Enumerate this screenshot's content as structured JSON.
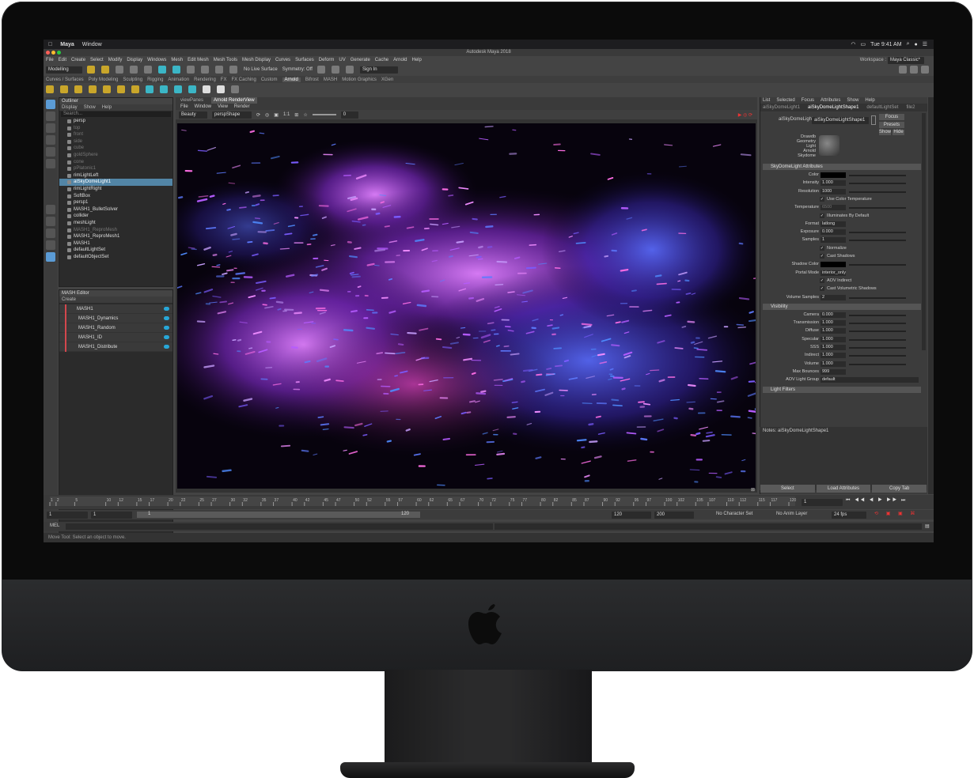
{
  "mac_menubar": {
    "app": "Maya",
    "window": "Window",
    "clock": "Tue 9:41 AM"
  },
  "window_title": "Autodesk Maya 2018",
  "menus": [
    "File",
    "Edit",
    "Create",
    "Select",
    "Modify",
    "Display",
    "Windows",
    "Mesh",
    "Edit Mesh",
    "Mesh Tools",
    "Mesh Display",
    "Curves",
    "Surfaces",
    "Deform",
    "UV",
    "Generate",
    "Cache",
    "Arnold",
    "Help"
  ],
  "workspace": {
    "label": "Workspace :",
    "value": "Maya Classic*"
  },
  "toolbar": {
    "mode": "Modelling",
    "live_surface": "No Live Surface",
    "symmetry": "Symmetry: Off",
    "sign_in": "Sign In"
  },
  "shelf_tabs": [
    "Curves / Surfaces",
    "Poly Modeling",
    "Sculpting",
    "Rigging",
    "Animation",
    "Rendering",
    "FX",
    "FX Caching",
    "Custom",
    "Arnold",
    "Bifrost",
    "MASH",
    "Motion Graphics",
    "XGen"
  ],
  "outliner": {
    "title": "Outliner",
    "menu": [
      "Display",
      "Show",
      "Help"
    ],
    "search": "Search...",
    "items": [
      {
        "label": "persp",
        "state": "normal"
      },
      {
        "label": "top",
        "state": "dim"
      },
      {
        "label": "front",
        "state": "dim"
      },
      {
        "label": "side",
        "state": "dim"
      },
      {
        "label": "cube",
        "state": "dim"
      },
      {
        "label": "goldSphere",
        "state": "dim"
      },
      {
        "label": "cone",
        "state": "dim"
      },
      {
        "label": "pPlatonic1",
        "state": "dim"
      },
      {
        "label": "rimLightLeft",
        "state": "normal"
      },
      {
        "label": "aiSkyDomeLight1",
        "state": "selected"
      },
      {
        "label": "rimLightRight",
        "state": "normal"
      },
      {
        "label": "SoftBox",
        "state": "normal"
      },
      {
        "label": "persp1",
        "state": "normal"
      },
      {
        "label": "MASH1_BulletSolver",
        "state": "normal"
      },
      {
        "label": "collider",
        "state": "normal"
      },
      {
        "label": "meshLight",
        "state": "normal"
      },
      {
        "label": "MASH1_ReproMesh",
        "state": "dim"
      },
      {
        "label": "MASH1_ReproMesh1",
        "state": "normal"
      },
      {
        "label": "MASH1",
        "state": "normal"
      },
      {
        "label": "defaultLightSet",
        "state": "normal"
      },
      {
        "label": "defaultObjectSet",
        "state": "normal"
      }
    ]
  },
  "mash_editor": {
    "title": "MASH Editor",
    "menu": "Create",
    "items": [
      "MASH1",
      "MASH1_Dynamics",
      "MASH1_Random",
      "MASH1_ID",
      "MASH1_Distribute"
    ]
  },
  "viewport": {
    "tabs": [
      "viewPanes",
      "Arnold RenderView"
    ],
    "menu": [
      "File",
      "Window",
      "View",
      "Render"
    ],
    "aov": "Beauty",
    "camera": "perspShape",
    "ratio": "1:1",
    "exposure": "0"
  },
  "attribute_editor": {
    "menu": [
      "List",
      "Selected",
      "Focus",
      "Attributes",
      "Show",
      "Help"
    ],
    "tabs": [
      "aiSkyDomeLight1",
      "aiSkyDomeLightShape1",
      "defaultLightSet",
      "file2"
    ],
    "node_label": "aiSkyDomeLight:",
    "node_value": "aiSkyDomeLightShape1",
    "focus": "Focus",
    "presets": "Presets",
    "show": "Show",
    "hide": "Hide",
    "swatch_caption": [
      "Drawdb",
      "Geometry",
      "Light",
      "Arnold",
      "Skydome"
    ],
    "section1": "SkyDomeLight Attributes",
    "rows": [
      {
        "label": "Color",
        "value": ""
      },
      {
        "label": "Intensity",
        "value": "1.000"
      },
      {
        "label": "Resolution",
        "value": "1000"
      },
      {
        "check": "Use Color Temperature"
      },
      {
        "label": "Temperature",
        "value": "6500"
      },
      {
        "check": "Illuminates By Default"
      },
      {
        "label": "Format",
        "value": "latlong"
      },
      {
        "label": "Exposure",
        "value": "0.000"
      },
      {
        "label": "Samples",
        "value": "1"
      },
      {
        "check": "Normalize"
      },
      {
        "check": "Cast Shadows"
      },
      {
        "label": "Shadow Color",
        "value": ""
      },
      {
        "label": "Portal Mode",
        "value": "interior_only"
      },
      {
        "check": "AOV Indirect"
      },
      {
        "check": "Cast Volumetric Shadows"
      },
      {
        "label": "Volume Samples",
        "value": "2"
      }
    ],
    "section2": "Visibility",
    "vis_rows": [
      {
        "label": "Camera",
        "value": "0.000"
      },
      {
        "label": "Transmission",
        "value": "1.000"
      },
      {
        "label": "Diffuse",
        "value": "1.000"
      },
      {
        "label": "Specular",
        "value": "1.000"
      },
      {
        "label": "SSS",
        "value": "1.000"
      },
      {
        "label": "Indirect",
        "value": "1.000"
      },
      {
        "label": "Volume",
        "value": "1.000"
      },
      {
        "label": "Max Bounces",
        "value": "999"
      },
      {
        "label": "AOV Light Group",
        "value": "default"
      }
    ],
    "section3": "Light Filters",
    "notes": "Notes:  aiSkyDomeLightShape1",
    "buttons": [
      "Select",
      "Load Attributes",
      "Copy Tab"
    ]
  },
  "timeline": {
    "ticks": [
      "1",
      "2",
      "5",
      "10",
      "12",
      "15",
      "17",
      "20",
      "22",
      "25",
      "27",
      "30",
      "32",
      "35",
      "37",
      "40",
      "42",
      "45",
      "47",
      "50",
      "52",
      "55",
      "57",
      "60",
      "62",
      "65",
      "67",
      "70",
      "72",
      "75",
      "77",
      "80",
      "82",
      "85",
      "87",
      "90",
      "92",
      "95",
      "97",
      "100",
      "102",
      "105",
      "107",
      "110",
      "112",
      "115",
      "117",
      "120"
    ],
    "current": "1"
  },
  "range": {
    "start": "1",
    "start2": "1",
    "slider_start": "1",
    "slider_end": "120",
    "end": "120",
    "end2": "200",
    "char_set": "No Character Set",
    "anim_layer": "No Anim Layer",
    "fps": "24 fps"
  },
  "mel": "MEL",
  "help_line": "Move Tool: Select an object to move."
}
